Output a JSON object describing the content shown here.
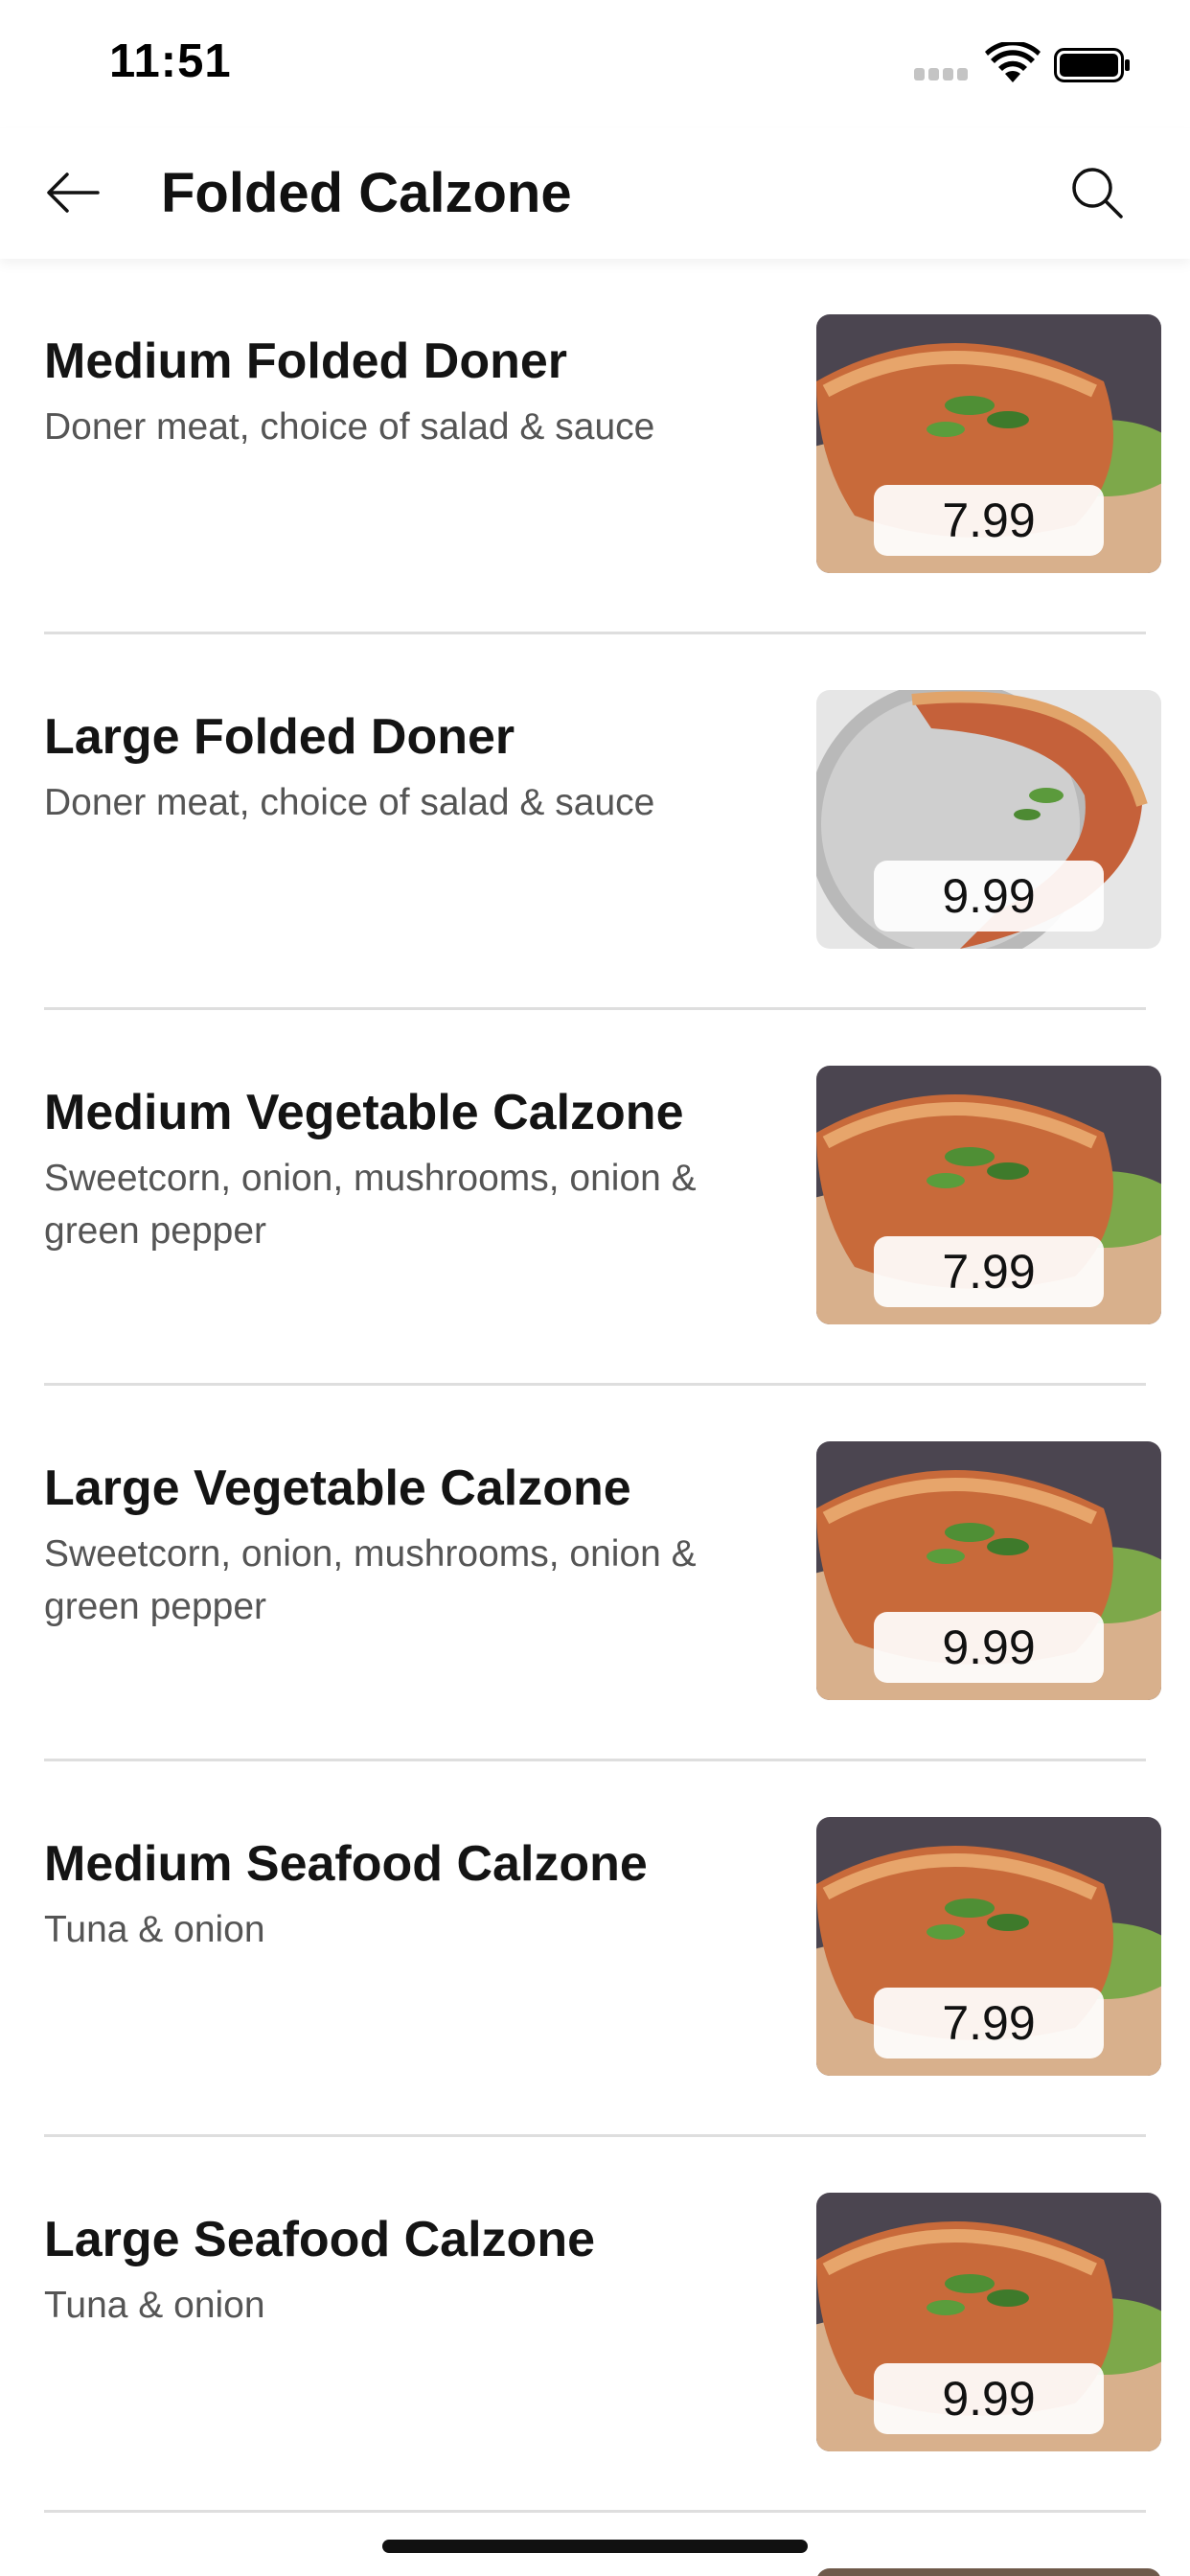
{
  "status_bar": {
    "time": "11:51"
  },
  "nav": {
    "title": "Folded Calzone"
  },
  "items": [
    {
      "name": "Medium Folded Doner",
      "description": "Doner meat, choice of salad & sauce",
      "price": "7.99"
    },
    {
      "name": "Large Folded Doner",
      "description": "Doner meat, choice of salad & sauce",
      "price": "9.99"
    },
    {
      "name": "Medium Vegetable Calzone",
      "description": "Sweetcorn, onion, mushrooms, onion & green pepper",
      "price": "7.99"
    },
    {
      "name": "Large Vegetable Calzone",
      "description": "Sweetcorn, onion, mushrooms, onion & green pepper",
      "price": "9.99"
    },
    {
      "name": "Medium Seafood Calzone",
      "description": "Tuna & onion",
      "price": "7.99"
    },
    {
      "name": "Large Seafood Calzone",
      "description": "Tuna & onion",
      "price": "9.99"
    }
  ]
}
